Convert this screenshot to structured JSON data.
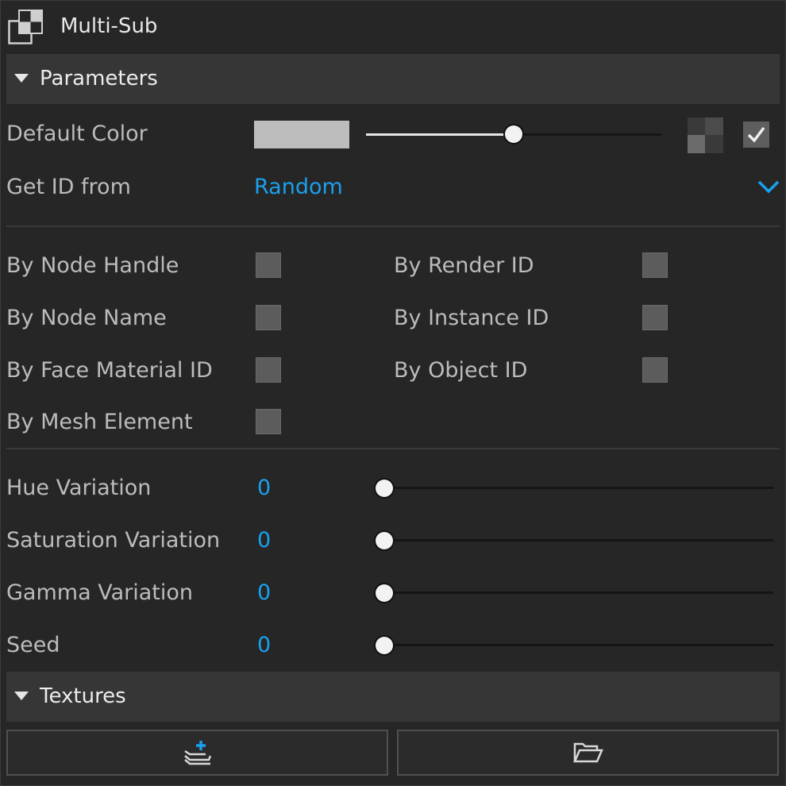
{
  "window": {
    "title": "Multi-Sub",
    "icon": "multi-sub-icon"
  },
  "sections": {
    "parameters": {
      "label": "Parameters",
      "expanded": true
    },
    "textures": {
      "label": "Textures",
      "expanded": true
    }
  },
  "default_color": {
    "label": "Default Color",
    "swatch_color": "#bdbdbd",
    "slider_value": 0.41,
    "texture_button_icon": "checker-texture-icon",
    "enabled_checked": true
  },
  "get_id_from": {
    "label": "Get ID from",
    "value": "Random",
    "icon": "chevron-down-icon"
  },
  "id_options": [
    {
      "label": "By Node Handle",
      "checked": false
    },
    {
      "label": "By Render ID",
      "checked": false
    },
    {
      "label": "By Node Name",
      "checked": false
    },
    {
      "label": "By Instance ID",
      "checked": false
    },
    {
      "label": "By Face Material ID",
      "checked": false
    },
    {
      "label": "By Object ID",
      "checked": false
    },
    {
      "label": "By Mesh Element",
      "checked": false
    }
  ],
  "variations": [
    {
      "label": "Hue Variation",
      "value": "0"
    },
    {
      "label": "Saturation Variation",
      "value": "0"
    },
    {
      "label": "Gamma Variation",
      "value": "0"
    },
    {
      "label": "Seed",
      "value": "0"
    }
  ],
  "buttons": {
    "add_texture_icon": "add-layer-icon",
    "open_icon": "folder-open-icon"
  },
  "colors": {
    "accent": "#1aa0ec",
    "background": "#262626",
    "header": "#363636"
  }
}
